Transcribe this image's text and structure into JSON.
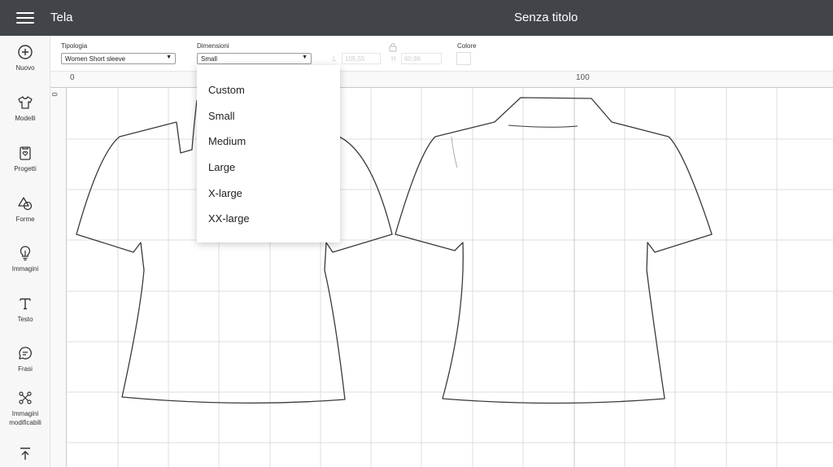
{
  "header": {
    "app_title": "Tela",
    "doc_title": "Senza titolo"
  },
  "sidebar": {
    "items": [
      {
        "label": "Nuovo",
        "icon": "plus-circle-icon"
      },
      {
        "label": "Modelli",
        "icon": "shirt-icon"
      },
      {
        "label": "Progetti",
        "icon": "project-icon"
      },
      {
        "label": "Forme",
        "icon": "shapes-icon"
      },
      {
        "label": "Immagini",
        "icon": "lightbulb-icon"
      },
      {
        "label": "Testo",
        "icon": "text-icon"
      },
      {
        "label": "Frasi",
        "icon": "chat-icon"
      },
      {
        "label": "Immagini modificabili",
        "icon": "edit-image-icon"
      },
      {
        "label": "",
        "icon": "upload-icon"
      }
    ]
  },
  "toolbar": {
    "tipologia_label": "Tipologia",
    "tipologia_value": "Women Short sleeve",
    "dimensioni_label": "Dimensioni",
    "dimensioni_value": "Small",
    "width_letter": "L",
    "width_value": "105,55",
    "height_letter": "H",
    "height_value": "60,96",
    "colore_label": "Colore"
  },
  "ruler": {
    "top_start": "0",
    "top_mid": "100",
    "left_start": "0"
  },
  "dropdown": {
    "options": [
      "Custom",
      "Small",
      "Medium",
      "Large",
      "X-large",
      "XX-large"
    ]
  }
}
